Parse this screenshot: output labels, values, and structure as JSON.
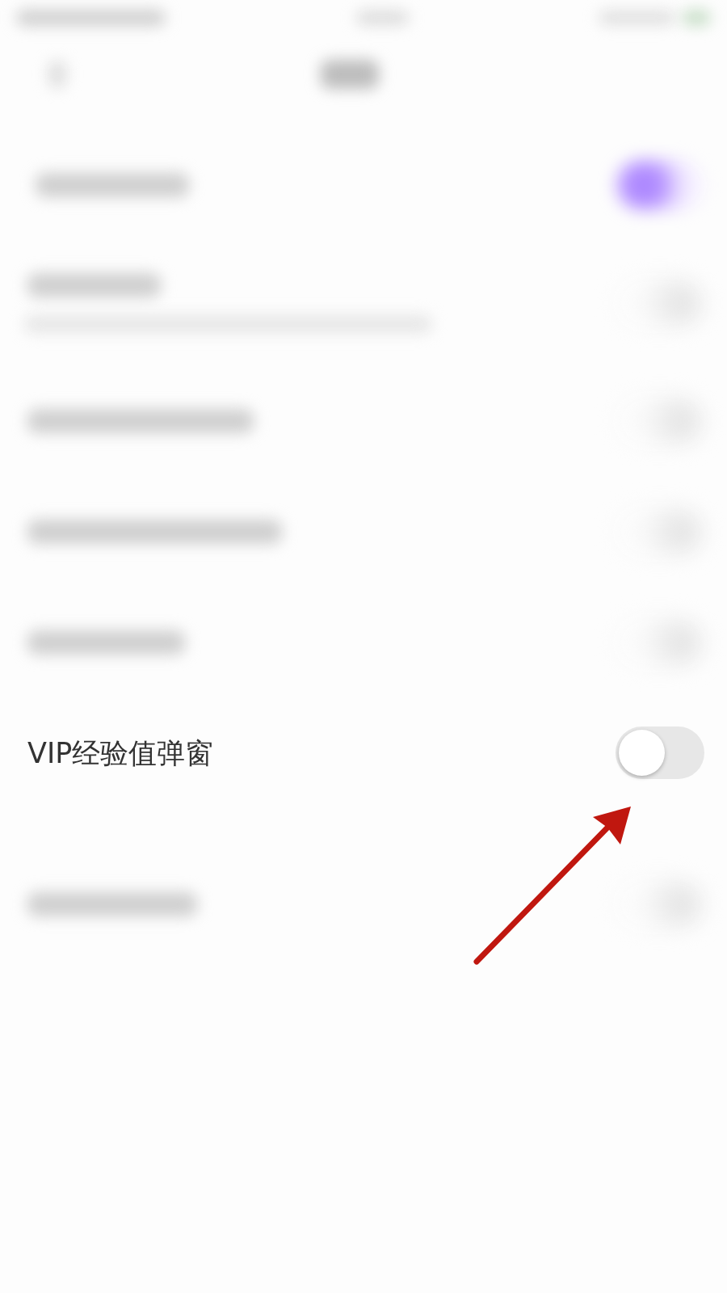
{
  "status_bar": {
    "kind": "blurred"
  },
  "nav_bar": {
    "kind": "blurred"
  },
  "sections": [
    {
      "items": [
        {
          "kind": "blurred",
          "on": true
        },
        {
          "kind": "blurred",
          "on": false,
          "has_description": true
        },
        {
          "kind": "blurred",
          "on": false
        },
        {
          "kind": "blurred",
          "on": false
        },
        {
          "kind": "blurred",
          "on": false
        },
        {
          "kind": "toggle",
          "label": "VIP经验值弹窗",
          "on": false
        }
      ]
    },
    {
      "items": [
        {
          "kind": "blurred",
          "on": false
        }
      ]
    }
  ],
  "annotation": {
    "kind": "arrow"
  }
}
